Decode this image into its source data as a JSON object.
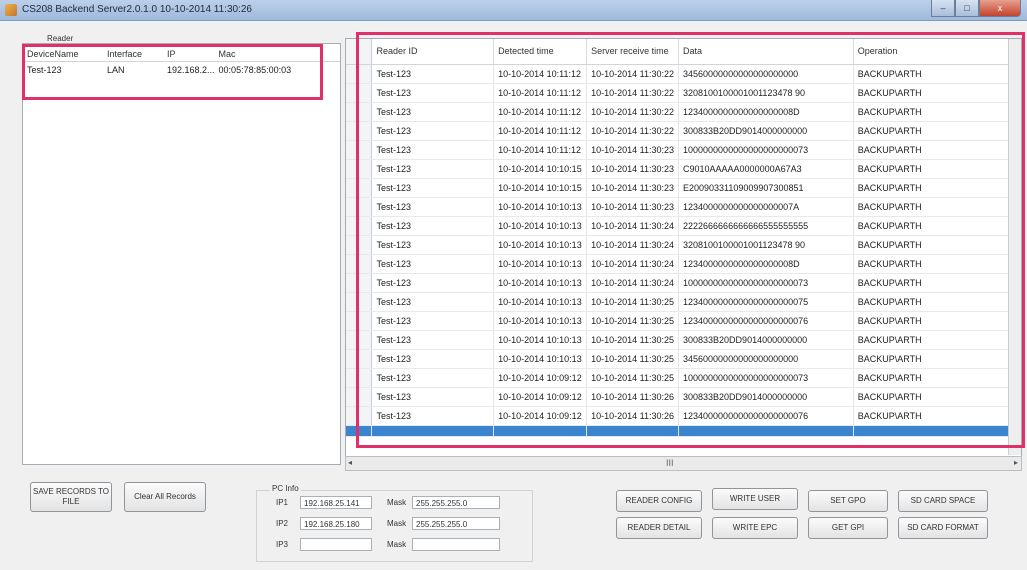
{
  "window": {
    "title": "CS208 Backend Server2.0.1.0  10-10-2014 11:30:26",
    "minimize": "–",
    "maximize": "□",
    "close": "x"
  },
  "reader_panel": {
    "title": "Reader",
    "columns": [
      "DeviceName",
      "Interface",
      "IP",
      "Mac"
    ],
    "rows": [
      {
        "device": "Test-123",
        "interface": "LAN",
        "ip": "192.168.2...",
        "mac": "00:05:78:85:00:03"
      }
    ]
  },
  "records": {
    "columns": [
      "Reader ID",
      "Detected time",
      "Server receive time",
      "Data",
      "Operation"
    ],
    "rows": [
      [
        "Test-123",
        "10-10-2014 10:11:12",
        "10-10-2014 11:30:22",
        "34560000000000000000000",
        "BACKUP\\ARTH"
      ],
      [
        "Test-123",
        "10-10-2014 10:11:12",
        "10-10-2014 11:30:22",
        "3208100100001001123478 90",
        "BACKUP\\ARTH"
      ],
      [
        "Test-123",
        "10-10-2014 10:11:12",
        "10-10-2014 11:30:22",
        "1234000000000000000008D",
        "BACKUP\\ARTH"
      ],
      [
        "Test-123",
        "10-10-2014 10:11:12",
        "10-10-2014 11:30:22",
        "300833B20DD9014000000000",
        "BACKUP\\ARTH"
      ],
      [
        "Test-123",
        "10-10-2014 10:11:12",
        "10-10-2014 11:30:23",
        "1000000000000000000000073",
        "BACKUP\\ARTH"
      ],
      [
        "Test-123",
        "10-10-2014 10:10:15",
        "10-10-2014 11:30:23",
        "C9010AAAAA0000000A67A3",
        "BACKUP\\ARTH"
      ],
      [
        "Test-123",
        "10-10-2014 10:10:15",
        "10-10-2014 11:30:23",
        "E20090331109009907300851",
        "BACKUP\\ARTH"
      ],
      [
        "Test-123",
        "10-10-2014 10:10:13",
        "10-10-2014 11:30:23",
        "1234000000000000000007A",
        "BACKUP\\ARTH"
      ],
      [
        "Test-123",
        "10-10-2014 10:10:13",
        "10-10-2014 11:30:24",
        "2222666666666666555555555",
        "BACKUP\\ARTH"
      ],
      [
        "Test-123",
        "10-10-2014 10:10:13",
        "10-10-2014 11:30:24",
        "3208100100001001123478 90",
        "BACKUP\\ARTH"
      ],
      [
        "Test-123",
        "10-10-2014 10:10:13",
        "10-10-2014 11:30:24",
        "1234000000000000000008D",
        "BACKUP\\ARTH"
      ],
      [
        "Test-123",
        "10-10-2014 10:10:13",
        "10-10-2014 11:30:24",
        "1000000000000000000000073",
        "BACKUP\\ARTH"
      ],
      [
        "Test-123",
        "10-10-2014 10:10:13",
        "10-10-2014 11:30:25",
        "1234000000000000000000075",
        "BACKUP\\ARTH"
      ],
      [
        "Test-123",
        "10-10-2014 10:10:13",
        "10-10-2014 11:30:25",
        "1234000000000000000000076",
        "BACKUP\\ARTH"
      ],
      [
        "Test-123",
        "10-10-2014 10:10:13",
        "10-10-2014 11:30:25",
        "300833B20DD9014000000000",
        "BACKUP\\ARTH"
      ],
      [
        "Test-123",
        "10-10-2014 10:10:13",
        "10-10-2014 11:30:25",
        "34560000000000000000000",
        "BACKUP\\ARTH"
      ],
      [
        "Test-123",
        "10-10-2014 10:09:12",
        "10-10-2014 11:30:25",
        "1000000000000000000000073",
        "BACKUP\\ARTH"
      ],
      [
        "Test-123",
        "10-10-2014 10:09:12",
        "10-10-2014 11:30:26",
        "300833B20DD9014000000000",
        "BACKUP\\ARTH"
      ],
      [
        "Test-123",
        "10-10-2014 10:09:12",
        "10-10-2014 11:30:26",
        "1234000000000000000000076",
        "BACKUP\\ARTH"
      ]
    ],
    "scroll_indicator": "III"
  },
  "buttons": {
    "save_records": "SAVE RECORDS TO FILE",
    "clear_all": "Clear All Records",
    "reader_config": "READER CONFIG",
    "write_user": "WRITE USER",
    "set_gpo": "SET GPO",
    "sd_card_space": "SD CARD SPACE",
    "reader_detail": "READER DETAIL",
    "write_epc": "WRITE EPC",
    "get_gpi": "GET GPI",
    "sd_card_format": "SD CARD FORMAT"
  },
  "pc_info": {
    "title": "PC Info",
    "ip1_label": "IP1",
    "ip1": "192.168.25.141",
    "ip2_label": "IP2",
    "ip2": "192.168.25.180",
    "ip3_label": "IP3",
    "ip3": "",
    "mask_label": "Mask",
    "mask1": "255.255.255.0",
    "mask2": "255.255.255.0",
    "mask3": ""
  },
  "colors": {
    "highlight": "#e0306a",
    "selection": "#3b84d0"
  }
}
